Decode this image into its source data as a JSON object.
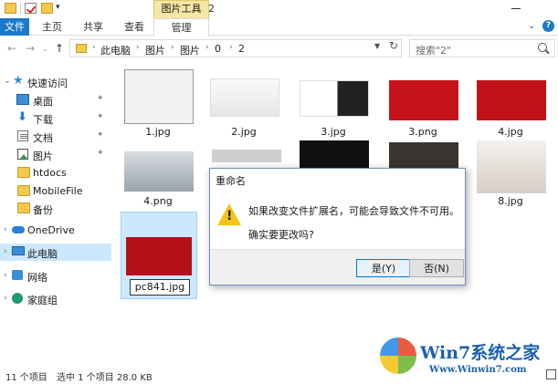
{
  "title_bar": {
    "context_tab_header": "图片工具",
    "window_title": "2"
  },
  "ribbon": {
    "tabs": [
      "文件",
      "主页",
      "共享",
      "查看",
      "管理"
    ]
  },
  "address": {
    "breadcrumbs": [
      "此电脑",
      "图片",
      "图片",
      "0",
      "2"
    ],
    "search_placeholder": "搜索\"2\""
  },
  "sidebar": {
    "items": [
      {
        "label": "快速访问",
        "icon": "star-icon"
      },
      {
        "label": "桌面",
        "icon": "desktop-icon",
        "pinned": true
      },
      {
        "label": "下载",
        "icon": "download-icon",
        "pinned": true
      },
      {
        "label": "文档",
        "icon": "document-icon",
        "pinned": true
      },
      {
        "label": "图片",
        "icon": "pictures-icon",
        "pinned": true
      },
      {
        "label": "htdocs",
        "icon": "folder-icon"
      },
      {
        "label": "MobileFile",
        "icon": "folder-icon"
      },
      {
        "label": "备份",
        "icon": "folder-icon"
      },
      {
        "label": "OneDrive",
        "icon": "cloud-icon"
      },
      {
        "label": "此电脑",
        "icon": "pc-icon",
        "selected": true
      },
      {
        "label": "网络",
        "icon": "network-icon"
      },
      {
        "label": "家庭组",
        "icon": "homegroup-icon"
      }
    ]
  },
  "files": {
    "row1": [
      "1.jpg",
      "2.jpg",
      "3.jpg",
      "3.png",
      "4.jpg"
    ],
    "row2": [
      "4.png",
      "8.jpg"
    ],
    "renaming": "pc841.jpg"
  },
  "dialog": {
    "title": "重命名",
    "message": "如果改变文件扩展名，可能会导致文件不可用。",
    "question": "确实要更改吗?",
    "yes_label": "是(Y)",
    "no_label": "否(N)"
  },
  "status": {
    "count": "11 个项目",
    "selection": "选中 1 个项目  28.0 KB"
  },
  "watermark": {
    "brand": "Win7系统之家",
    "url": "Www.Winwin7.com"
  }
}
